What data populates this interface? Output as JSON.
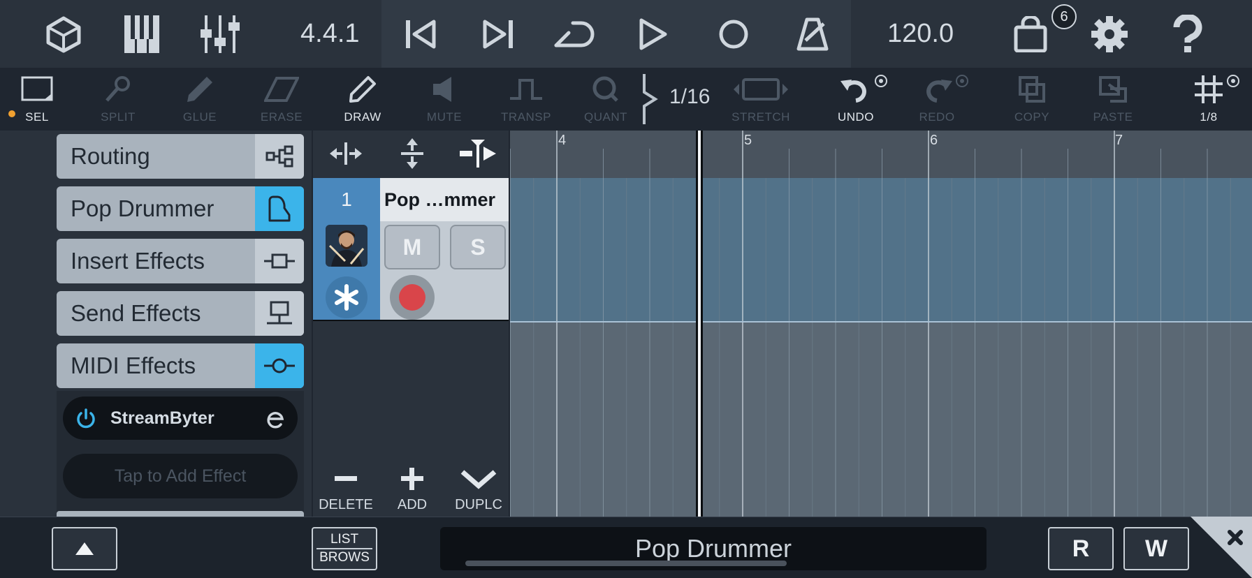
{
  "colors": {
    "accent": "#3bb4ea",
    "record": "#d9454a",
    "selection_dot": "#f0a030",
    "lane": "#527289"
  },
  "top_bar": {
    "position": "4.4.1",
    "tempo": "120.0",
    "store_badge": "6",
    "icons": [
      "cube-icon",
      "piano-keys-icon",
      "mixer-icon",
      "skip-back-icon",
      "skip-forward-icon",
      "loop-icon",
      "play-icon",
      "record-icon",
      "metronome-icon",
      "store-bag-icon",
      "gear-icon",
      "help-icon"
    ]
  },
  "tools": {
    "sel": "SEL",
    "split": "SPLIT",
    "glue": "GLUE",
    "erase": "ERASE",
    "draw": "DRAW",
    "mute": "MUTE",
    "transp": "TRANSP",
    "quant": "QUANT",
    "quant_value": "1/16",
    "stretch": "STRETCH",
    "undo": "UNDO",
    "redo": "REDO",
    "copy": "COPY",
    "paste": "PASTE",
    "grid": "1/8"
  },
  "left_panel": {
    "categories": [
      {
        "label": "Routing",
        "icon": "routing-icon"
      },
      {
        "label": "Pop Drummer",
        "icon": "piano-icon"
      },
      {
        "label": "Insert Effects",
        "icon": "insert-icon"
      },
      {
        "label": "Send Effects",
        "icon": "send-icon"
      },
      {
        "label": "MIDI Effects",
        "icon": "midi-effect-icon"
      }
    ],
    "plugin": {
      "name": "StreamByter"
    },
    "add_effect": "Tap to Add Effect"
  },
  "track": {
    "number": "1",
    "name": "Pop …mmer",
    "mute": "M",
    "solo": "S"
  },
  "track_actions": {
    "delete": "DELETE",
    "add": "ADD",
    "duplicate": "DUPLC"
  },
  "timeline": {
    "bars": [
      "4",
      "5",
      "6",
      "7"
    ]
  },
  "bottom_bar": {
    "list_top": "LIST",
    "list_bottom": "BROWS",
    "track_name": "Pop Drummer",
    "read": "R",
    "write": "W"
  }
}
